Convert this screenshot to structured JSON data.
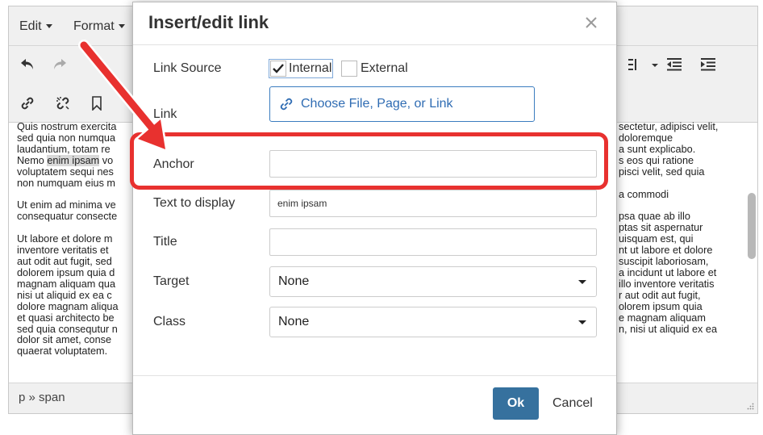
{
  "editor": {
    "menu": {
      "edit_label": "Edit",
      "format_label": "Format"
    },
    "content_paragraphs": [
      {
        "lines": [
          "Quis nostrum exercita",
          "sed quia non numqua",
          "laudantium, totam re",
          "Nemo {hl} vo",
          "voluptatem sequi nes",
          "non numquam eius m"
        ],
        "right_lines": [
          "sectetur, adipisci velit,",
          "doloremque",
          "a sunt explicabo.",
          "s eos qui ratione",
          "pisci velit, sed quia",
          ""
        ],
        "highlight": "enim ipsam"
      },
      {
        "lines": [
          "Ut enim ad minima ve",
          "consequatur consecte"
        ],
        "right_lines": [
          "a commodi",
          ""
        ]
      },
      {
        "lines": [
          "Ut labore et dolore m",
          "inventore veritatis et",
          "aut odit aut fugit, sed",
          "dolorem ipsum quia d",
          "magnam aliquam qua",
          "nisi ut aliquid ex ea c",
          "dolore magnam aliqua",
          "et quasi architecto be",
          "sed quia consequtur n",
          "dolor sit amet, conse",
          "quaerat voluptatem."
        ],
        "right_lines": [
          "psa quae ab illo",
          "ptas sit aspernatur",
          "uisquam est, qui",
          "nt ut labore et dolore",
          "suscipit laboriosam,",
          "a incidunt ut labore et",
          " illo inventore veritatis",
          "r aut odit aut fugit,",
          "olorem ipsum quia",
          "e magnam aliquam",
          "n, nisi ut aliquid ex ea"
        ]
      }
    ],
    "status_path": "p » span"
  },
  "dialog": {
    "title": "Insert/edit link",
    "link_source_label": "Link Source",
    "internal_label": "Internal",
    "internal_checked": true,
    "external_label": "External",
    "external_checked": false,
    "link_label": "Link",
    "choose_button_label": "Choose File, Page, or Link",
    "anchor_label": "Anchor",
    "anchor_value": "",
    "text_to_display_label": "Text to display",
    "text_to_display_value": "enim ipsam",
    "title_label": "Title",
    "title_value": "",
    "target_label": "Target",
    "target_value": "None",
    "class_label": "Class",
    "class_value": "None",
    "ok_label": "Ok",
    "cancel_label": "Cancel"
  },
  "colors": {
    "annotation_red": "#e8312f",
    "primary_button": "#36719e",
    "link_blue": "#2f6cb3"
  }
}
